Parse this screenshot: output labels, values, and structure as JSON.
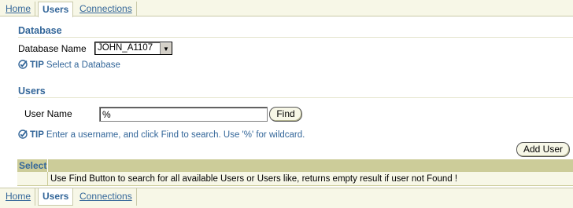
{
  "tabs": [
    {
      "label": "Home",
      "active": false
    },
    {
      "label": "Users",
      "active": true
    },
    {
      "label": "Connections",
      "active": false
    }
  ],
  "database_section": {
    "heading": "Database",
    "field_label": "Database Name",
    "selected_value": "JOHN_A1107",
    "tip_word": "TIP",
    "tip_text": "Select a Database"
  },
  "users_section": {
    "heading": "Users",
    "field_label": "User Name",
    "input_value": "%",
    "find_label": "Find",
    "tip_word": "TIP",
    "tip_text": "Enter a username, and click Find to search. Use '%' for wildcard."
  },
  "add_user_label": "Add User",
  "results": {
    "column_select": "Select",
    "empty_message": "Use Find Button to search for all available Users or Users like, returns empty result if user not Found !"
  },
  "colors": {
    "accent": "#336699",
    "band": "#cccc99",
    "tab_bg": "#f7f7e7"
  }
}
